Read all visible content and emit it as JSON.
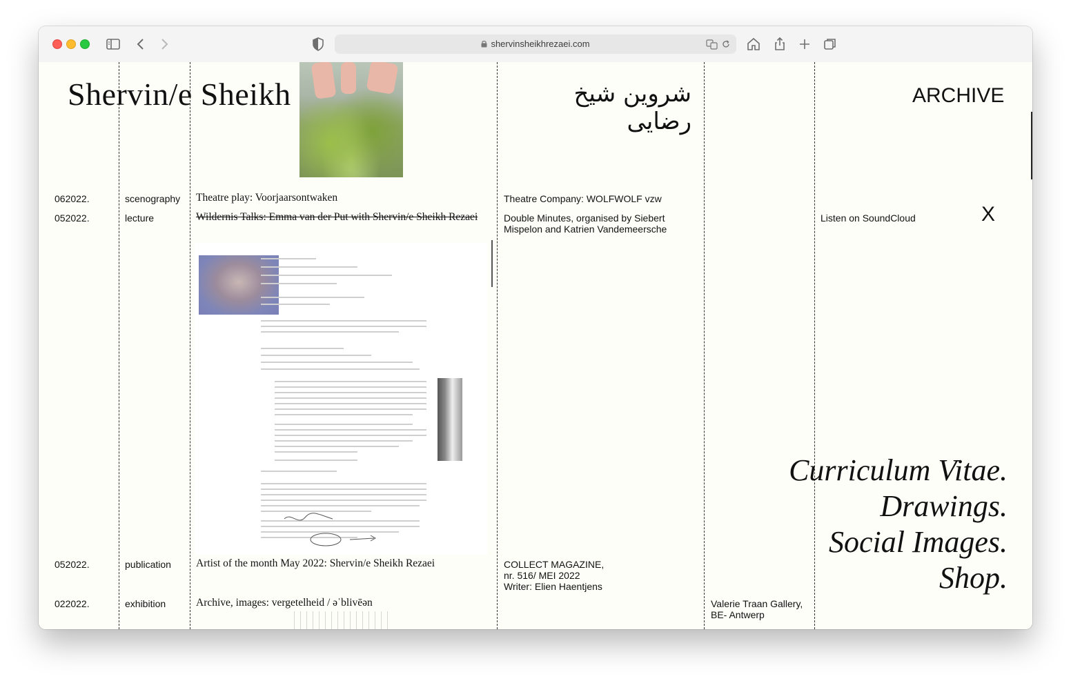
{
  "browser": {
    "url": "shervinsheikhrezaei.com"
  },
  "header": {
    "title": "Shervin/e Sheikh",
    "title_persian": "شروین شیخ رضایی",
    "archive": "ARCHIVE"
  },
  "rows": [
    {
      "date": "062022.",
      "type": "scenography",
      "title": "Theatre play: Voorjaarsontwaken",
      "info": "Theatre Company: WOLFWOLF vzw",
      "location": "",
      "link": ""
    },
    {
      "date": "052022.",
      "type": "lecture",
      "title": "Wildernis Talks: Emma van der Put with Shervin/e Sheikh Rezaei",
      "info_lines": [
        "Double Minutes, organised by Siebert",
        "Mispelon and Katrien Vandemeersche"
      ],
      "location": "",
      "link": "Listen on SoundCloud"
    },
    {
      "date": "052022.",
      "type": "publication",
      "title": "Artist of the month May 2022: Shervin/e Sheikh Rezaei",
      "info_lines": [
        "COLLECT MAGAZINE,",
        "nr. 516/ MEI 2022",
        "Writer: Elien Haentjens"
      ],
      "location": "",
      "link": ""
    },
    {
      "date": "022022.",
      "type": "exhibition",
      "title": "Archive, images: vergetelheid / əˈblivēən",
      "info": "",
      "location_lines": [
        "Valerie Traan Gallery,",
        "BE- Antwerp"
      ],
      "link": ""
    }
  ],
  "close_label": "X",
  "nav": {
    "cv": "Curriculum Vitae.",
    "drawings": "Drawings.",
    "social": "Social Images.",
    "shop": "Shop."
  }
}
